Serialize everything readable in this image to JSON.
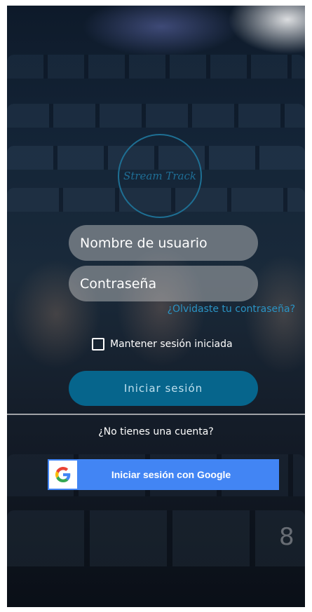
{
  "logo": {
    "text": "Stream Track"
  },
  "login_form": {
    "username_placeholder": "Nombre de usuario",
    "password_placeholder": "Contraseña",
    "forgot_password": "¿Olvidaste tu contraseña?",
    "remember_label": "Mantener sesión iniciada",
    "remember_checked": false,
    "login_button": "Iniciar sesión",
    "no_account": "¿No tienes una cuenta?"
  },
  "google": {
    "button_label": "Iniciar sesión con Google",
    "icon": "google-g-icon"
  },
  "background": {
    "seat_number": "8"
  },
  "colors": {
    "primary_button": "#06658c",
    "link": "#2a93c4",
    "google_blue": "#4285f4",
    "input_bg": "rgba(205,205,205,0.45)"
  }
}
